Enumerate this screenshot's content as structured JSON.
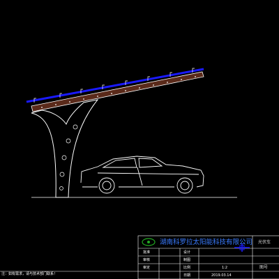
{
  "drawing": {
    "colors": {
      "background": "#000000",
      "lines": "#ffffff",
      "panel": "#1a1aff",
      "beam_fill": "#5a2a1a",
      "company": "#3a7cff",
      "logo": "#22aa22"
    }
  },
  "title_block": {
    "company": "湖南科罗拉太阳能科技有限公司",
    "rows": [
      {
        "left": "设计",
        "right": ""
      },
      {
        "left": "制图",
        "right": ""
      },
      {
        "left": "比例",
        "right": "1:2"
      },
      {
        "left": "日期",
        "right": "2019.03.14"
      }
    ],
    "right_label_1": "光伏车",
    "right_label_2": "图号",
    "side_label_1": "批准",
    "side_label_2": "审核",
    "side_label_3": "审定"
  },
  "notes": {
    "footer": "注：如有需求，请与技术部门联系！"
  }
}
